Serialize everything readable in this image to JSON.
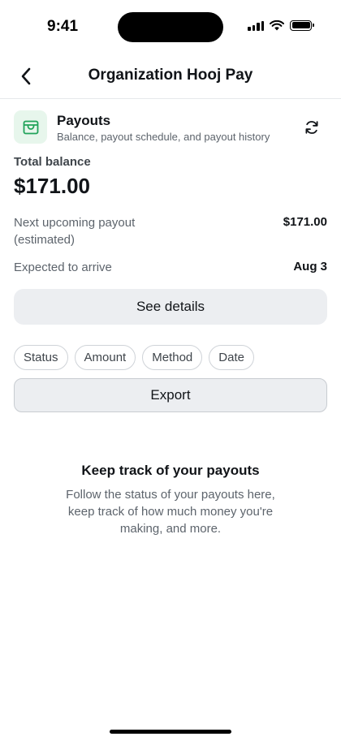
{
  "status_bar": {
    "time": "9:41"
  },
  "nav": {
    "title": "Organization Hooj Pay"
  },
  "payouts": {
    "title": "Payouts",
    "subtitle": "Balance, payout schedule, and payout history",
    "accent_color": "#21a35a",
    "icon_bg": "#e7f6ec"
  },
  "balance": {
    "label": "Total balance",
    "value": "$171.00"
  },
  "next_payout": {
    "label_line1": "Next upcoming payout",
    "label_line2": "(estimated)",
    "value": "$171.00"
  },
  "expected": {
    "label": "Expected to arrive",
    "value": "Aug 3"
  },
  "details_button": {
    "label": "See details"
  },
  "filters": [
    {
      "label": "Status"
    },
    {
      "label": "Amount"
    },
    {
      "label": "Method"
    },
    {
      "label": "Date"
    }
  ],
  "export_button": {
    "label": "Export"
  },
  "empty_state": {
    "title": "Keep track of your payouts",
    "body": "Follow the status of your payouts here, keep track of how much money you're making, and more."
  }
}
